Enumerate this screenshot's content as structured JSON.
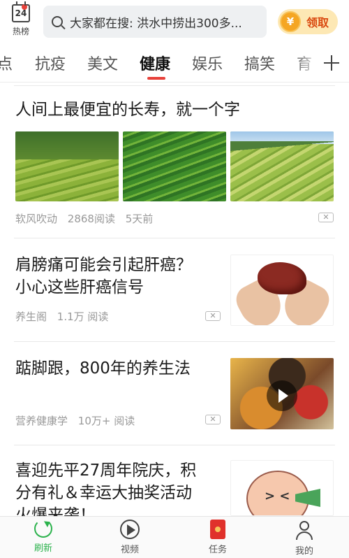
{
  "header": {
    "hot_badge_number": "24",
    "hot_label": "热榜",
    "search_text": "大家都在搜: 洪水中捞出300多...",
    "reward_icon": "¥",
    "reward_label": "领取"
  },
  "tabs": [
    {
      "label": "点"
    },
    {
      "label": "抗疫"
    },
    {
      "label": "美文"
    },
    {
      "label": "健康",
      "active": true
    },
    {
      "label": "娱乐"
    },
    {
      "label": "搞笑"
    },
    {
      "label": "育"
    }
  ],
  "feed": [
    {
      "title": "人间上最便宜的长寿，就一个字",
      "source": "软风吹动",
      "reads": "2868阅读",
      "time": "5天前"
    },
    {
      "title_line1": "肩膀痛可能会引起肝癌？",
      "title_line2": "小心这些肝癌信号",
      "source": "养生阁",
      "reads": "1.1万 阅读"
    },
    {
      "title": "踮脚跟，800年的养生法",
      "source": "营养健康学",
      "reads": "10万+ 阅读"
    },
    {
      "title_line1": "喜迎先平27周年院庆，积",
      "title_line2": "分有礼＆幸运大抽奖活动",
      "title_line3": "火爆来袭！"
    }
  ],
  "bottom_nav": [
    {
      "label": "刷新",
      "icon": "refresh-icon",
      "active": true
    },
    {
      "label": "视频",
      "icon": "play-icon"
    },
    {
      "label": "任务",
      "icon": "red-envelope-icon"
    },
    {
      "label": "我的",
      "icon": "user-icon"
    }
  ],
  "colors": {
    "accent_red": "#e8413a",
    "active_green": "#2bb24c",
    "reward_bg": "#fde8b4",
    "reward_text": "#d9480f"
  }
}
